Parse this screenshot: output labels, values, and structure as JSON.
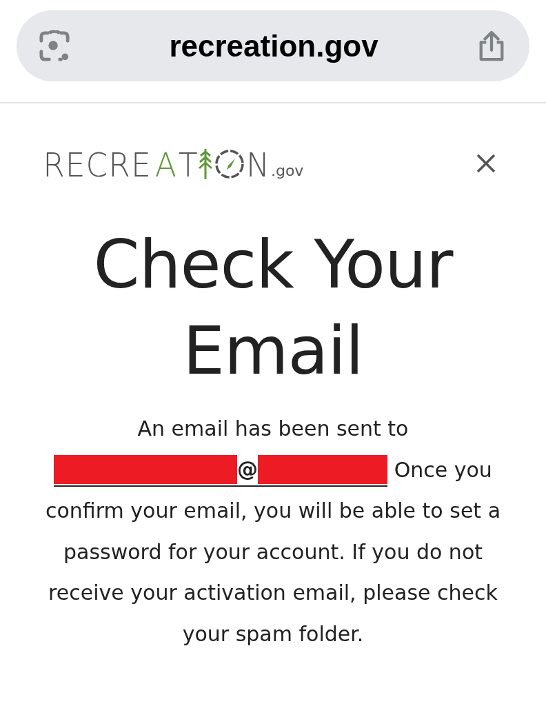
{
  "browser": {
    "url": "recreation.gov"
  },
  "logo": {
    "segments": [
      {
        "kind": "text",
        "text": "RECRE"
      },
      {
        "kind": "accent",
        "text": "A"
      },
      {
        "kind": "text",
        "text": "T"
      },
      {
        "kind": "tree"
      },
      {
        "kind": "compass"
      },
      {
        "kind": "text",
        "text": "N"
      }
    ],
    "suffix": ".gov"
  },
  "dialog": {
    "title": "Check Your Email",
    "message_before": "An email has been sent to",
    "email": {
      "parts": [
        {
          "kind": "redacted"
        },
        {
          "kind": "text",
          "text": "@"
        },
        {
          "kind": "redacted"
        }
      ]
    },
    "message_after": "Once you confirm your email, you will be able to set a password for your account. If you do not receive your activation email, please check your spam folder."
  }
}
